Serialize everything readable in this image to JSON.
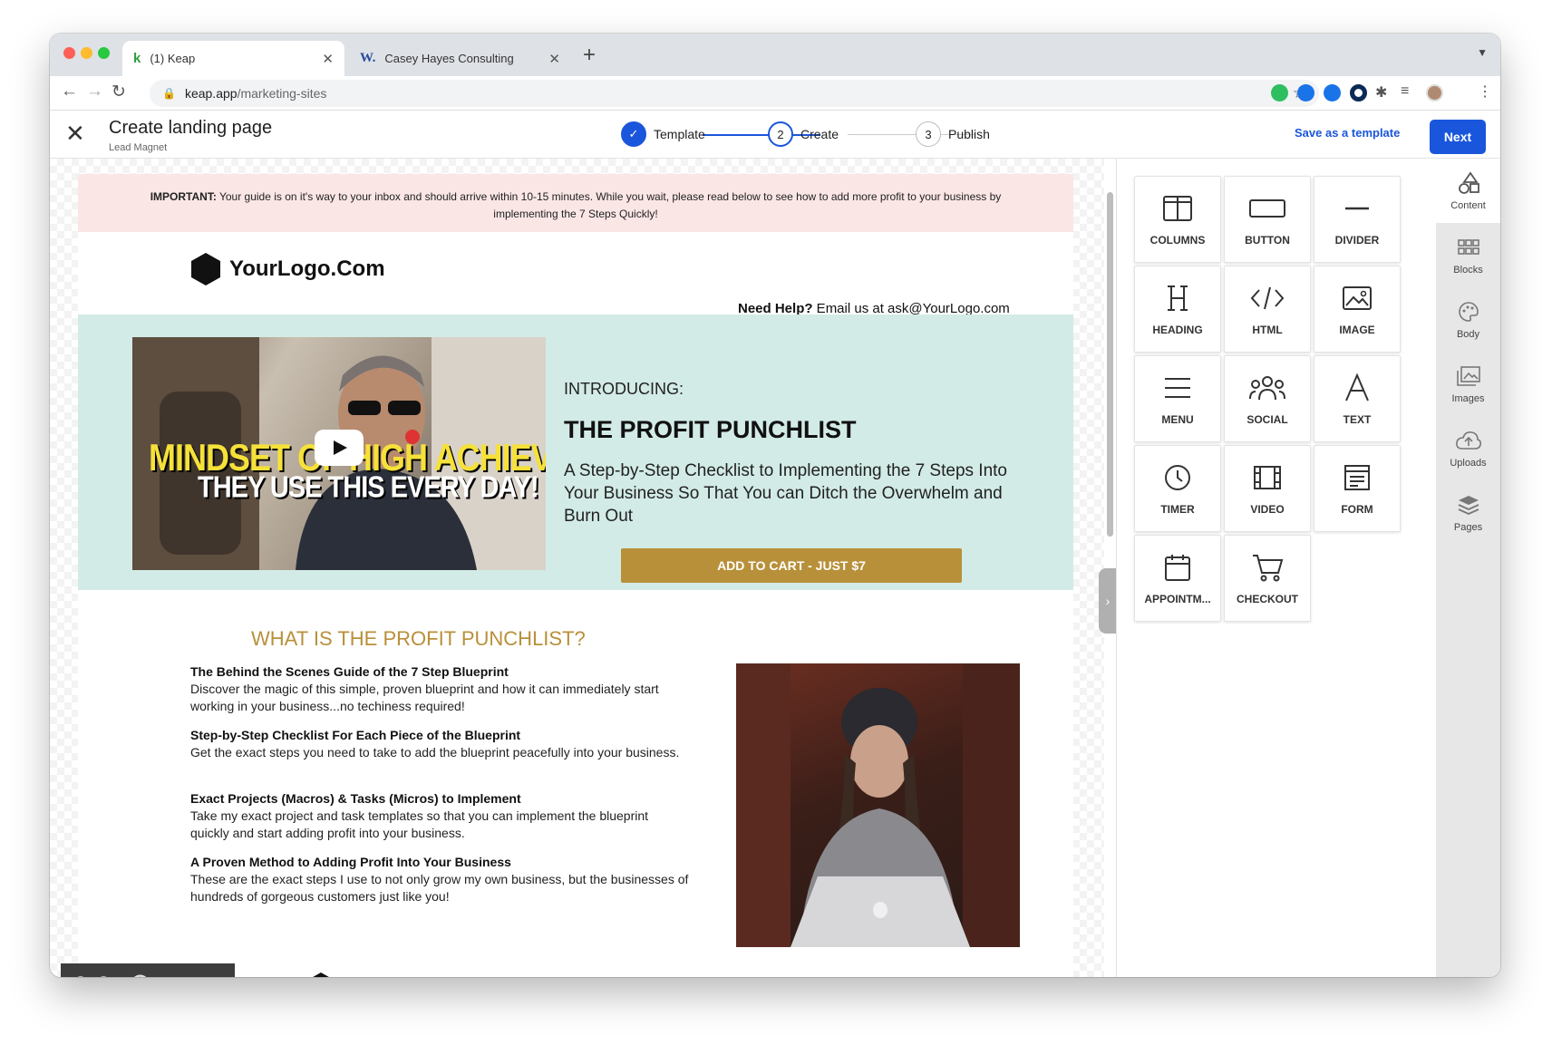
{
  "browser": {
    "tabs": [
      {
        "favicon": "k",
        "title": "(1) Keap"
      },
      {
        "favicon": "W.",
        "title": "Casey Hayes Consulting"
      }
    ],
    "address_host": "keap.app",
    "address_path": "/marketing-sites"
  },
  "header": {
    "title": "Create landing page",
    "subtitle": "Lead Magnet",
    "steps": [
      {
        "num": "",
        "label": "Template"
      },
      {
        "num": "2",
        "label": "Create"
      },
      {
        "num": "3",
        "label": "Publish"
      }
    ],
    "save_template": "Save as a template",
    "next": "Next"
  },
  "page": {
    "notice_bold": "IMPORTANT:",
    "notice_text": " Your guide is on it's way to your inbox and should arrive within 10-15 minutes. While you wait, please read below to see how to add more profit to your business by implementing the 7 Steps Quickly!",
    "logo": "YourLogo.Com",
    "help_bold": "Need Help?",
    "help_text": "  Email us at ask@YourLogo.com",
    "video_line1": "MINDSET OF HIGH ACHIEVERS",
    "video_line2": "THEY USE THIS EVERY DAY!",
    "introducing": "INTRODUCING:",
    "hero_title": "THE PROFIT PUNCHLIST",
    "hero_desc": "A Step-by-Step Checklist to Implementing the 7 Steps Into Your Business So That You can Ditch the Overwhelm and Burn Out",
    "cart_button": "ADD TO CART - JUST $7",
    "what_title": "WHAT IS THE PROFIT PUNCHLIST?",
    "features": [
      {
        "title": "The Behind the Scenes Guide of the 7 Step Blueprint",
        "text": "Discover the magic of this simple, proven blueprint and how it can immediately start working in your business...no techiness required!"
      },
      {
        "title": "Step-by-Step Checklist For Each Piece of the Blueprint",
        "text": "Get the exact steps you need to take to add the blueprint peacefully into your business."
      },
      {
        "title": "Exact Projects (Macros) & Tasks (Micros) to Implement",
        "text": "Take my exact project and task templates so that you can implement the blueprint quickly and start adding profit into your business."
      },
      {
        "title": "A Proven Method to Adding Profit Into Your Business",
        "text": "These are the exact steps I use to not only grow my own business, but the businesses of hundreds of gorgeous customers just like you!"
      }
    ]
  },
  "content_tiles": [
    {
      "label": "COLUMNS",
      "icon": "columns-icon"
    },
    {
      "label": "BUTTON",
      "icon": "button-icon"
    },
    {
      "label": "DIVIDER",
      "icon": "divider-icon"
    },
    {
      "label": "HEADING",
      "icon": "heading-icon"
    },
    {
      "label": "HTML",
      "icon": "html-icon"
    },
    {
      "label": "IMAGE",
      "icon": "image-icon"
    },
    {
      "label": "MENU",
      "icon": "menu-icon"
    },
    {
      "label": "SOCIAL",
      "icon": "social-icon"
    },
    {
      "label": "TEXT",
      "icon": "text-icon"
    },
    {
      "label": "TIMER",
      "icon": "timer-icon"
    },
    {
      "label": "VIDEO",
      "icon": "video-icon"
    },
    {
      "label": "FORM",
      "icon": "form-icon"
    },
    {
      "label": "APPOINTM...",
      "icon": "appointment-icon"
    },
    {
      "label": "CHECKOUT",
      "icon": "cart-icon"
    }
  ],
  "sidebar": [
    {
      "label": "Content",
      "icon": "shapes-icon",
      "active": true
    },
    {
      "label": "Blocks",
      "icon": "grid-icon"
    },
    {
      "label": "Body",
      "icon": "palette-icon"
    },
    {
      "label": "Images",
      "icon": "images-icon"
    },
    {
      "label": "Uploads",
      "icon": "cloud-upload-icon"
    },
    {
      "label": "Pages",
      "icon": "layers-icon"
    }
  ],
  "colors": {
    "primary": "#1a56db",
    "gold": "#b8903a",
    "hero_bg": "#d2ebe6",
    "notice_bg": "#fbe6e6"
  }
}
